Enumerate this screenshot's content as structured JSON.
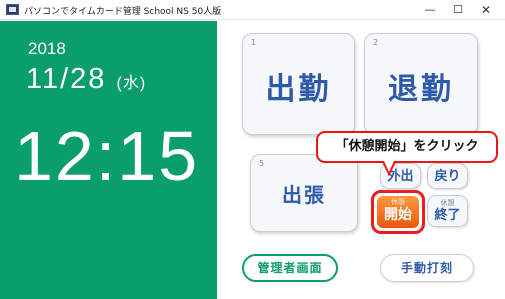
{
  "window": {
    "title": "パソコンでタイムカード管理 School NS 50人版",
    "minimize": "—",
    "maximize": "☐",
    "close": "✕"
  },
  "clock": {
    "year": "2018",
    "date": "11/28",
    "day_of_week": "(水)",
    "time": "12:15"
  },
  "buttons": {
    "clock_in": {
      "number": "1",
      "label": "出勤"
    },
    "clock_out": {
      "number": "2",
      "label": "退勤"
    },
    "business_trip": {
      "number": "5",
      "label": "出張"
    },
    "go_out": {
      "top": "外出",
      "label": "外出"
    },
    "return": {
      "top": "",
      "label": "戻り"
    },
    "break_start": {
      "top": "休憩",
      "label": "開始"
    },
    "break_end": {
      "top": "休憩",
      "label": "終了"
    },
    "admin_screen": "管理者画面",
    "manual_entry": "手動打刻"
  },
  "callout": {
    "text": "「休憩開始」をクリック"
  },
  "colors": {
    "panel_green": "#0a9e68",
    "button_text_blue": "#2f5aa8",
    "highlight_red": "#ee1c1c",
    "break_orange": "#e8560e"
  }
}
